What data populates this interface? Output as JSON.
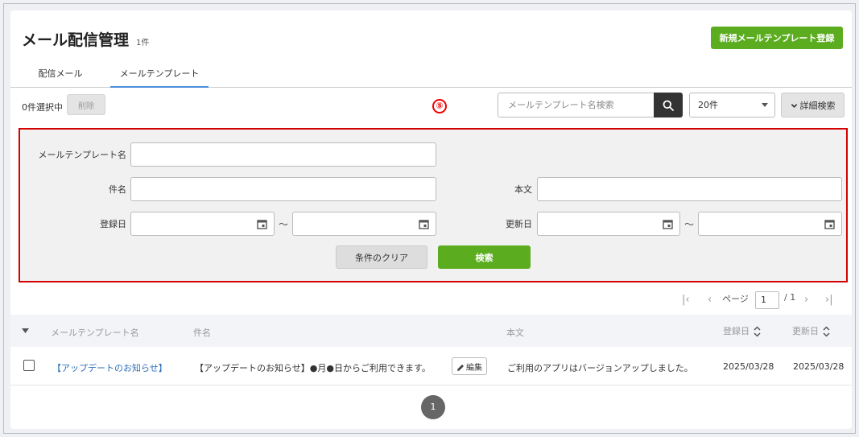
{
  "header": {
    "title": "メール配信管理",
    "count": "1件",
    "new_button": "新規メールテンプレート登録"
  },
  "tabs": [
    {
      "label": "配信メール"
    },
    {
      "label": "メールテンプレート"
    }
  ],
  "toolbar": {
    "selected": "0件選択中",
    "delete": "削除",
    "step_marker": "⑤",
    "search_placeholder": "メールテンプレート名検索",
    "per_page": "20件",
    "detail_search": "詳細検索"
  },
  "filter": {
    "template_name_label": "メールテンプレート名",
    "subject_label": "件名",
    "body_label": "本文",
    "registered_label": "登録日",
    "updated_label": "更新日",
    "tilde": "～",
    "clear_button": "条件のクリア",
    "search_button": "検索"
  },
  "pager": {
    "page_label": "ページ",
    "current": "1",
    "total": "/ 1"
  },
  "table": {
    "columns": {
      "name": "メールテンプレート名",
      "subject": "件名",
      "body": "本文",
      "registered": "登録日",
      "updated": "更新日"
    },
    "rows": [
      {
        "name": "【アップデートのお知らせ】",
        "subject": "【アップデートのお知らせ】●月●日からご利用できます。",
        "edit": "編集",
        "body": "ご利用のアプリはバージョンアップしました。",
        "registered": "2025/03/28",
        "updated": "2025/03/28"
      }
    ]
  },
  "pagination": {
    "page": "1"
  },
  "colors": {
    "primary": "#5bad1f",
    "highlight_border": "#d40000",
    "link": "#2d6fb8"
  }
}
